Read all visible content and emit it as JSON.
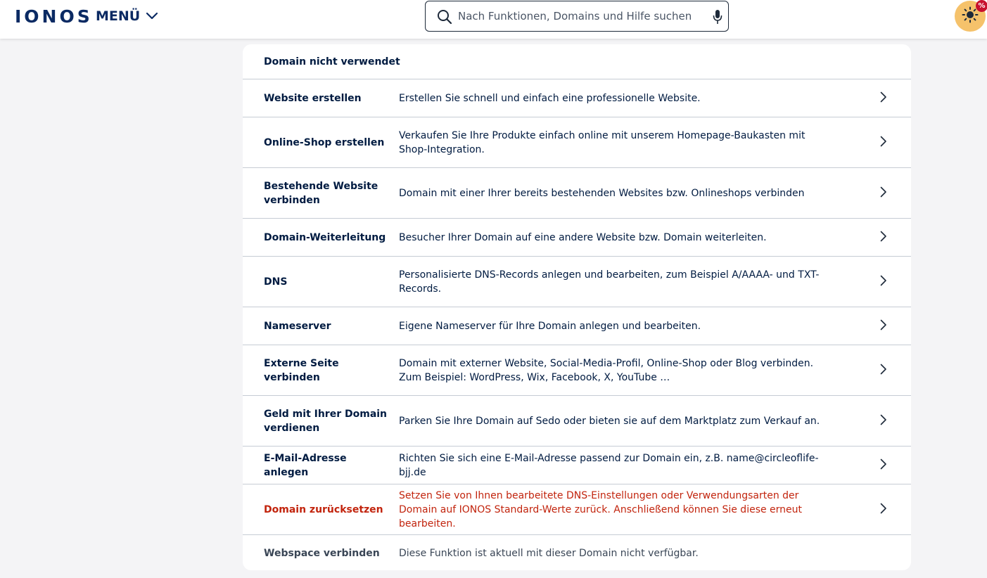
{
  "header": {
    "logo": "IONOS",
    "menu_label": "MENÜ",
    "search_placeholder": "Nach Funktionen, Domains und Hilfe suchen",
    "promo_badge": "%"
  },
  "card": {
    "title": "Domain nicht verwendet",
    "rows": [
      {
        "label": "Website erstellen",
        "desc": "Erstellen Sie schnell und einfach eine professionelle Website."
      },
      {
        "label": "Online-Shop erstellen",
        "desc": "Verkaufen Sie Ihre Produkte einfach online mit unserem Homepage-Baukasten mit Shop-Integration."
      },
      {
        "label": "Bestehende Website verbinden",
        "desc": "Domain mit einer Ihrer bereits bestehenden Websites bzw. Onlineshops verbinden"
      },
      {
        "label": "Domain-Weiterleitung",
        "desc": "Besucher Ihrer Domain auf eine andere Website bzw. Domain weiterleiten."
      },
      {
        "label": "DNS",
        "desc": "Personalisierte DNS-Records anlegen und bearbeiten, zum Beispiel A/AAAA- und TXT-Records."
      },
      {
        "label": "Nameserver",
        "desc": "Eigene Nameserver für Ihre Domain anlegen und bearbeiten."
      },
      {
        "label": "Externe Seite verbinden",
        "desc": "Domain mit externer Website, Social-Media-Profil, Online-Shop oder Blog verbinden. Zum Beispiel: WordPress, Wix, Facebook, X, YouTube …"
      },
      {
        "label": "Geld mit Ihrer Domain verdienen",
        "desc": "Parken Sie Ihre Domain auf Sedo oder bieten sie auf dem Marktplatz zum Verkauf an."
      },
      {
        "label": "E-Mail-Adresse anlegen",
        "desc": "Richten Sie sich eine E-Mail-Adresse passend zur Domain ein, z.B. name@circleoflife-bjj.de"
      },
      {
        "label": "Domain zurücksetzen",
        "desc": "Setzen Sie von Ihnen bearbeitete DNS-Einstellungen oder Verwendungsarten der Domain auf IONOS Standard-Werte zurück. Anschließend können Sie diese erneut bearbeiten."
      },
      {
        "label": "Webspace verbinden",
        "desc": "Diese Funktion ist aktuell mit dieser Domain nicht verfügbar."
      }
    ]
  },
  "colors": {
    "brand": "#0b2a63",
    "text": "#001b41",
    "danger": "#c2240d",
    "promo": "#f5c26b",
    "badge": "#c8102e"
  }
}
